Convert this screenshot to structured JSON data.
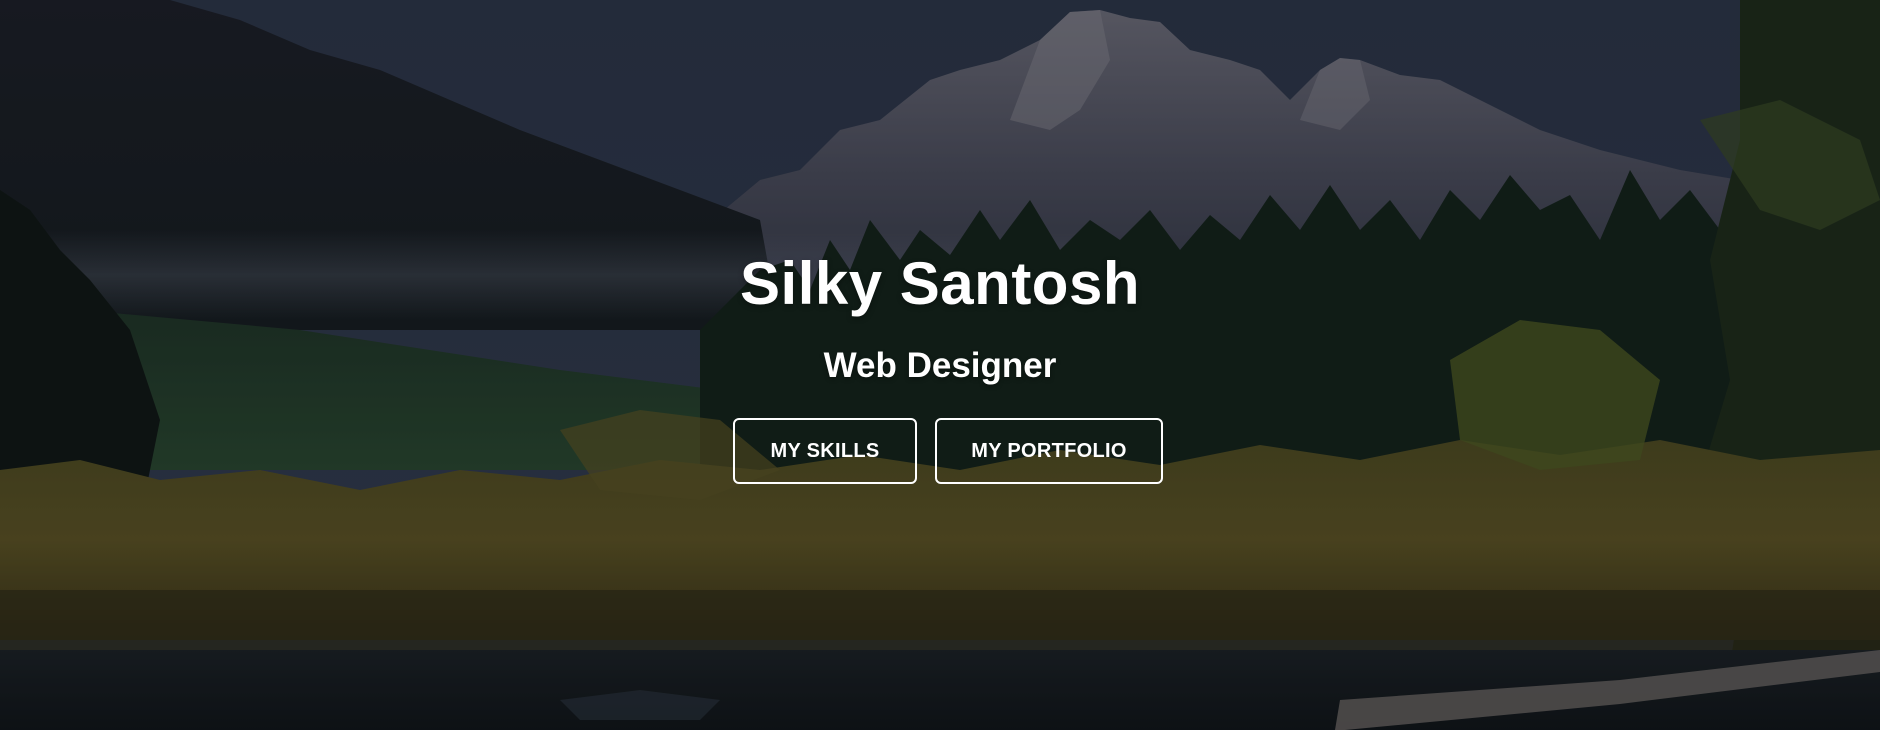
{
  "hero": {
    "title": "Silky Santosh",
    "subtitle": "Web Designer",
    "background_image": "mountain-forest-lake-landscape",
    "overlay_color": "#0b1118"
  },
  "buttons": {
    "skills_label": "MY SKILLS",
    "portfolio_label": "MY PORTFOLIO"
  },
  "colors": {
    "text": "#ffffff",
    "button_border": "#ffffff",
    "sky": "#2c3547",
    "forest_dark": "#0f1a14",
    "foliage_gold": "#6b6424"
  }
}
